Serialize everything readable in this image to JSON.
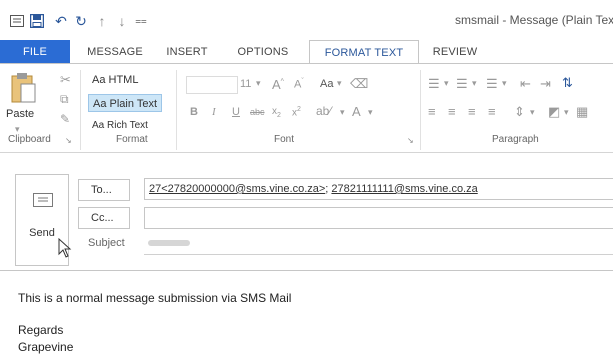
{
  "window": {
    "title": "smsmail - Message (Plain Tex"
  },
  "quick_access": [
    "save-icon",
    "undo-icon",
    "redo-icon",
    "up-arrow-icon",
    "down-arrow-icon",
    "customize-icon"
  ],
  "tabs": [
    {
      "label": "FILE"
    },
    {
      "label": "MESSAGE"
    },
    {
      "label": "INSERT"
    },
    {
      "label": "OPTIONS"
    },
    {
      "label": "FORMAT TEXT"
    },
    {
      "label": "REVIEW"
    }
  ],
  "ribbon": {
    "clipboard": {
      "label": "Clipboard",
      "paste": "Paste"
    },
    "format": {
      "label": "Format",
      "html": "Aa HTML",
      "plain": "Aa Plain Text",
      "rich": "Aa Rich Text"
    },
    "font": {
      "label": "Font",
      "size": "11",
      "case": "Aa"
    },
    "paragraph": {
      "label": "Paragraph"
    }
  },
  "message": {
    "send_label": "Send",
    "to_label": "To...",
    "cc_label": "Cc...",
    "subject_label": "Subject",
    "to_recipient_1": "27<27820000000@sms.vine.co.za>",
    "to_separator": "; ",
    "to_recipient_2": "27821111111@sms.vine.co.za",
    "cc_value": ""
  },
  "body": {
    "line1": "This is a normal message submission via SMS Mail",
    "line2": "Regards",
    "line3": "Grapevine"
  },
  "colors": {
    "accent": "#2b579a",
    "file_tab": "#2b6cd4",
    "selected": "#cde6f7"
  }
}
